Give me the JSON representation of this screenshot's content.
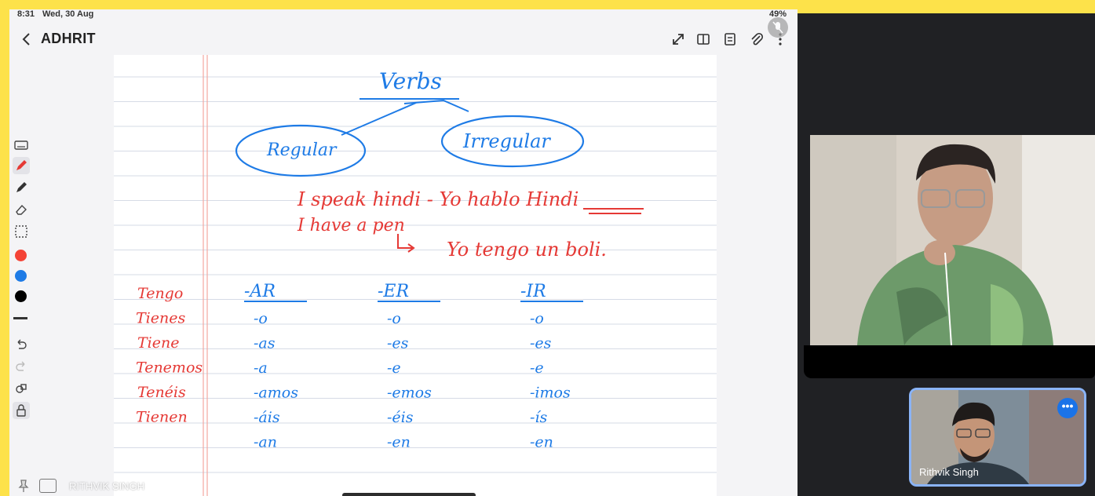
{
  "status": {
    "time": "8:31",
    "date": "Wed, 30 Aug",
    "right": "49%"
  },
  "note": {
    "title": "ADHRIT"
  },
  "toolbar": {
    "colors": {
      "red": "#f44336",
      "blue": "#1e7be6",
      "black": "#000000"
    }
  },
  "handwriting": {
    "heading": "Verbs",
    "branch_left": "Regular",
    "branch_right": "Irregular",
    "sentence1": "I speak hindi - Yo hablo Hindi",
    "sentence2": "I have a pen",
    "sentence3": "Yo tengo un boli.",
    "conjugation_persons": [
      "Tengo",
      "Tienes",
      "Tiene",
      "Tenemos",
      "Tenéis",
      "Tienen"
    ],
    "columns": [
      {
        "header": "-AR",
        "endings": [
          "-o",
          "-as",
          "-a",
          "-amos",
          "-áis",
          "-an"
        ]
      },
      {
        "header": "-ER",
        "endings": [
          "-o",
          "-es",
          "-e",
          "-emos",
          "-éis",
          "-en"
        ]
      },
      {
        "header": "-IR",
        "endings": [
          "-o",
          "-es",
          "-e",
          "-imos",
          "-ís",
          "-en"
        ]
      }
    ],
    "ink_colors": {
      "blue": "#1e7be6",
      "red": "#e53935"
    }
  },
  "presenter": {
    "label": "RITHVIK SINGH"
  },
  "self_view": {
    "name": "Rithvik Singh",
    "menu_icon": "more-dots-icon"
  }
}
